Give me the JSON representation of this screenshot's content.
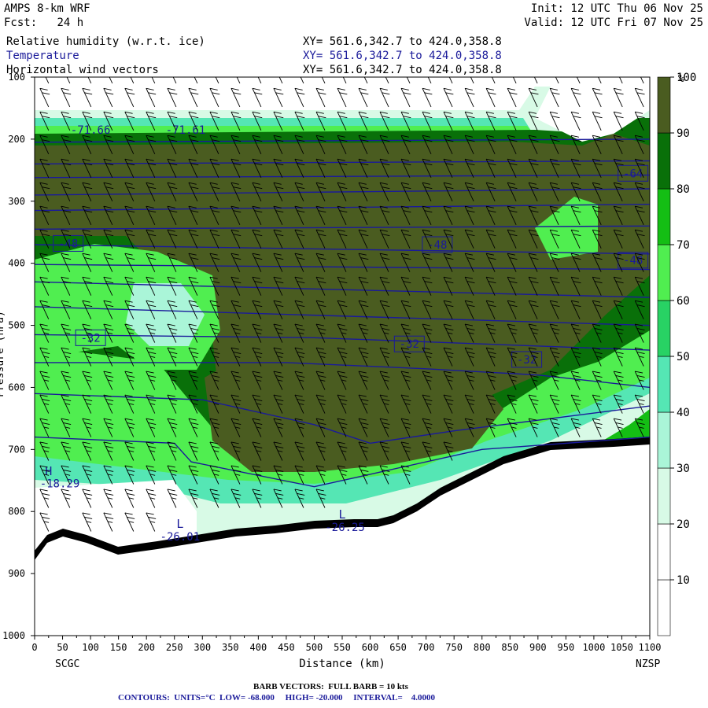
{
  "header": {
    "model": "AMPS 8-km WRF",
    "fcst_label": "Fcst:",
    "fcst_value": "24 h",
    "init": "Init: 12 UTC Thu 06 Nov 25",
    "valid": "Valid: 12 UTC Fri 07 Nov 25",
    "fields": [
      {
        "name": "Relative humidity (w.r.t. ice)",
        "xy": "XY= 561.6,342.7 to 424.0,358.8",
        "color": "#000000"
      },
      {
        "name": "Temperature",
        "xy": "XY= 561.6,342.7 to 424.0,358.8",
        "color": "#1a1a9a"
      },
      {
        "name": "Horizontal wind vectors",
        "xy": "XY= 561.6,342.7 to 424.0,358.8",
        "color": "#000000"
      }
    ]
  },
  "footer": {
    "barb": "BARB VECTORS:  FULL BARB = 10 kts",
    "contours": "CONTOURS:  UNITS=°C  LOW= -68.000     HIGH= -20.000     INTERVAL=    4.0000"
  },
  "chart_data": {
    "type": "heatmap",
    "xlabel": "Distance (km)",
    "ylabel": "Pressure (hPa)",
    "xlim": [
      0,
      1100
    ],
    "ylim": [
      1000,
      100
    ],
    "x_ticks": [
      0,
      50,
      100,
      150,
      200,
      250,
      300,
      350,
      400,
      450,
      500,
      550,
      600,
      650,
      700,
      750,
      800,
      850,
      900,
      950,
      1000,
      1050,
      1100
    ],
    "y_ticks": [
      100,
      200,
      300,
      400,
      500,
      600,
      700,
      800,
      900,
      1000
    ],
    "start_label": "SCGC",
    "end_label": "NZSP",
    "colorbar": {
      "unit": "%",
      "levels": [
        10,
        20,
        30,
        40,
        50,
        60,
        70,
        80,
        90,
        100
      ],
      "colors": [
        "#ffffff",
        "#ffffff",
        "#d8fae6",
        "#aaf5d8",
        "#55e6b4",
        "#28d264",
        "#50ee50",
        "#14be14",
        "#097009",
        "#4a5c20"
      ]
    },
    "contour_labels": [
      {
        "text": "-71.66",
        "x": 100,
        "p": 185
      },
      {
        "text": "-71.61",
        "x": 270,
        "p": 185
      },
      {
        "text": "-64",
        "x": 1070,
        "p": 255
      },
      {
        "text": "-48",
        "x": 60,
        "p": 368
      },
      {
        "text": "-48",
        "x": 720,
        "p": 370
      },
      {
        "text": "-48",
        "x": 1070,
        "p": 395
      },
      {
        "text": "-32",
        "x": 100,
        "p": 520
      },
      {
        "text": "-32",
        "x": 670,
        "p": 530
      },
      {
        "text": "-32",
        "x": 880,
        "p": 555
      },
      {
        "text": "H",
        "x": 25,
        "p": 735
      },
      {
        "text": "-18.29",
        "x": 45,
        "p": 755
      },
      {
        "text": "L",
        "x": 260,
        "p": 820
      },
      {
        "text": "-26.01",
        "x": 260,
        "p": 840
      },
      {
        "text": "L",
        "x": 550,
        "p": 805
      },
      {
        "text": "-26.25",
        "x": 555,
        "p": 825
      }
    ]
  }
}
